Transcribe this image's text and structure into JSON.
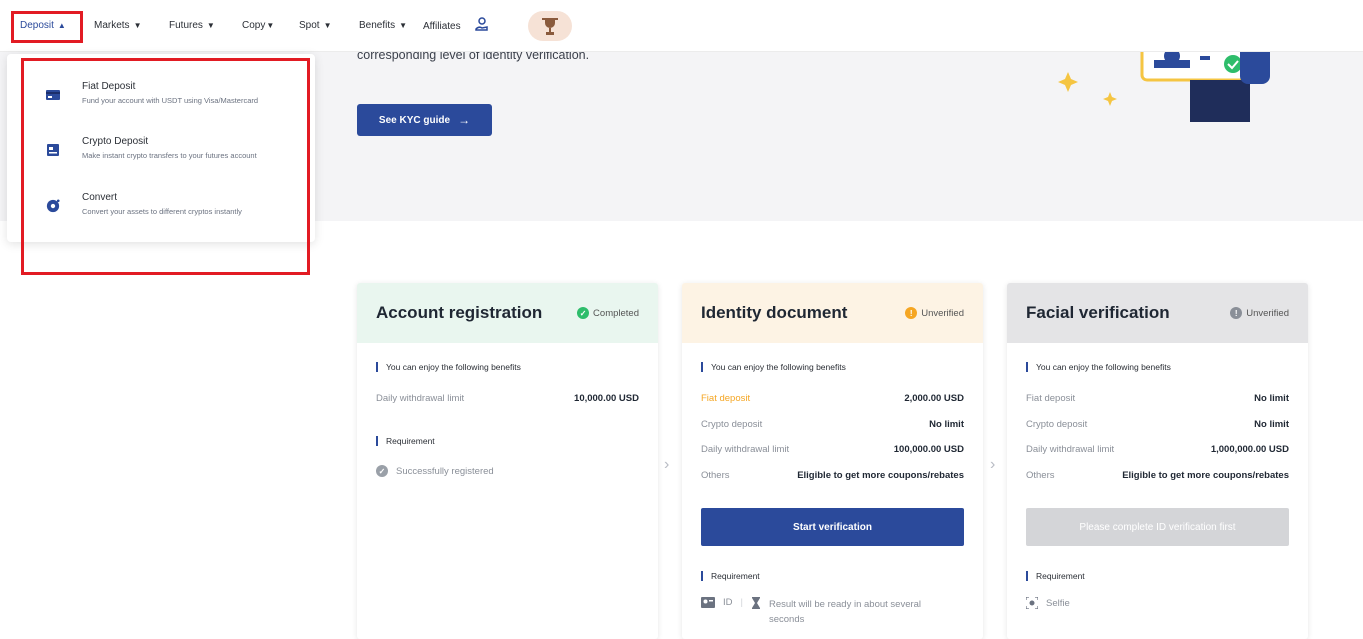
{
  "nav": {
    "items": [
      {
        "label": "Deposit",
        "caret": "▲"
      },
      {
        "label": "Markets",
        "caret": "▼"
      },
      {
        "label": "Futures",
        "caret": "▼"
      },
      {
        "label": "Copy",
        "caret": "▼"
      },
      {
        "label": "Spot",
        "caret": "▼"
      },
      {
        "label": "Benefits",
        "caret": "▼"
      },
      {
        "label": "Affiliates",
        "caret": ""
      }
    ]
  },
  "dropdown": {
    "items": [
      {
        "title": "Fiat Deposit",
        "desc": "Fund your account with USDT using Visa/Mastercard",
        "icon": "card-icon"
      },
      {
        "title": "Crypto Deposit",
        "desc": "Make instant crypto transfers to your futures account",
        "icon": "wallet-icon"
      },
      {
        "title": "Convert",
        "desc": "Convert your assets to different cryptos instantly",
        "icon": "convert-icon"
      }
    ]
  },
  "hero": {
    "text": "corresponding level of identity verification.",
    "button": "See KYC guide",
    "arrow": "→"
  },
  "cards": [
    {
      "title": "Account registration",
      "status": "Completed",
      "status_color": "#2ebd6b",
      "head_bg": "#e9f6ef",
      "benefits_label": "You can enjoy the following benefits",
      "benefits": [
        {
          "k": "Daily withdrawal limit",
          "v": "10,000.00 USD"
        }
      ],
      "req_label": "Requirement",
      "req": "Successfully registered"
    },
    {
      "title": "Identity document",
      "status": "Unverified",
      "status_color": "#f5a623",
      "head_bg": "#fdf3e4",
      "benefits_label": "You can enjoy the following benefits",
      "benefits": [
        {
          "k": "Fiat deposit",
          "v": "2,000.00 USD"
        },
        {
          "k": "Crypto deposit",
          "v": "No limit"
        },
        {
          "k": "Daily withdrawal limit",
          "v": "100,000.00 USD"
        },
        {
          "k": "Others",
          "v": "Eligible to get more coupons/rebates"
        }
      ],
      "button": "Start verification",
      "req_label": "Requirement",
      "req_id": "ID",
      "req_note_1": "Result will be ready in about several",
      "req_note_2": "seconds"
    },
    {
      "title": "Facial verification",
      "status": "Unverified",
      "status_color": "#8a8f98",
      "head_bg": "#e4e4e6",
      "benefits_label": "You can enjoy the following benefits",
      "benefits": [
        {
          "k": "Fiat deposit",
          "v": "No limit"
        },
        {
          "k": "Crypto deposit",
          "v": "No limit"
        },
        {
          "k": "Daily withdrawal limit",
          "v": "1,000,000.00 USD"
        },
        {
          "k": "Others",
          "v": "Eligible to get more coupons/rebates"
        }
      ],
      "button": "Please complete ID verification first",
      "req_label": "Requirement",
      "req": "Selfie"
    }
  ],
  "chevron": "›",
  "colors": {
    "accent": "#2b4a9b",
    "highlight": "#e21b23",
    "fiat_orange": "#f5a623"
  }
}
